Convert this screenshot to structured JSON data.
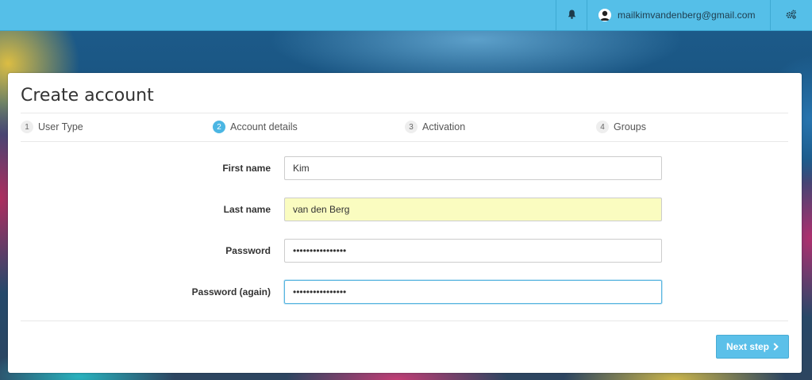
{
  "navbar": {
    "user_email": "mailkimvandenberg@gmail.com",
    "icons": [
      "bell-icon",
      "user-avatar-icon",
      "gears-icon"
    ]
  },
  "card": {
    "title": "Create account"
  },
  "steps": [
    {
      "number": "1",
      "label": "User Type",
      "active": false
    },
    {
      "number": "2",
      "label": "Account details",
      "active": true
    },
    {
      "number": "3",
      "label": "Activation",
      "active": false
    },
    {
      "number": "4",
      "label": "Groups",
      "active": false
    }
  ],
  "form": {
    "first_name": {
      "label": "First name",
      "value": "Kim"
    },
    "last_name": {
      "label": "Last name",
      "value": "van den Berg"
    },
    "password": {
      "label": "Password",
      "value": "••••••••••••••••"
    },
    "password_again": {
      "label": "Password (again)",
      "value": "••••••••••••••••"
    }
  },
  "actions": {
    "next_label": "Next step"
  },
  "colors": {
    "navbar": "#55bfe8",
    "accent": "#4bb6e3",
    "autofill": "#fafcc0",
    "button": "#5bc0e9"
  }
}
